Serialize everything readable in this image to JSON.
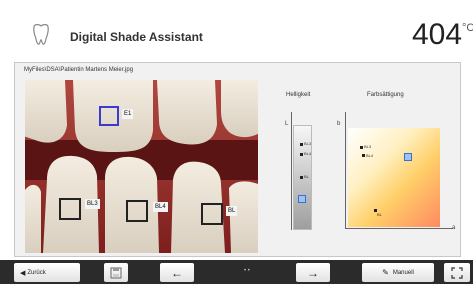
{
  "header": {
    "title": "Digital Shade Assistant",
    "temperature": "404",
    "temperature_unit": "°C"
  },
  "file_path": "MyFiles\\DSA\\Patientin Martens Meier.jpg",
  "photo": {
    "samples": [
      {
        "label": "E1",
        "active": true
      },
      {
        "label": "BL3",
        "active": false
      },
      {
        "label": "BL4",
        "active": false
      },
      {
        "label": "BL",
        "active": false
      }
    ]
  },
  "brightness": {
    "title": "Helligkeit",
    "axis": "L",
    "markers": [
      "BL3",
      "BL4",
      "BL",
      "E1"
    ]
  },
  "saturation": {
    "title": "Farbsättigung",
    "y_axis": "b",
    "x_axis": "a",
    "markers": [
      "BL3",
      "BL4",
      "E1",
      "BL"
    ]
  },
  "toolbar": {
    "back_label": "Zurück",
    "manual_label": "Manuell",
    "page_indicator": "• •"
  },
  "colors": {
    "selected_box": "#3b3bd0",
    "toolbar_bg": "#2b2b2b"
  }
}
